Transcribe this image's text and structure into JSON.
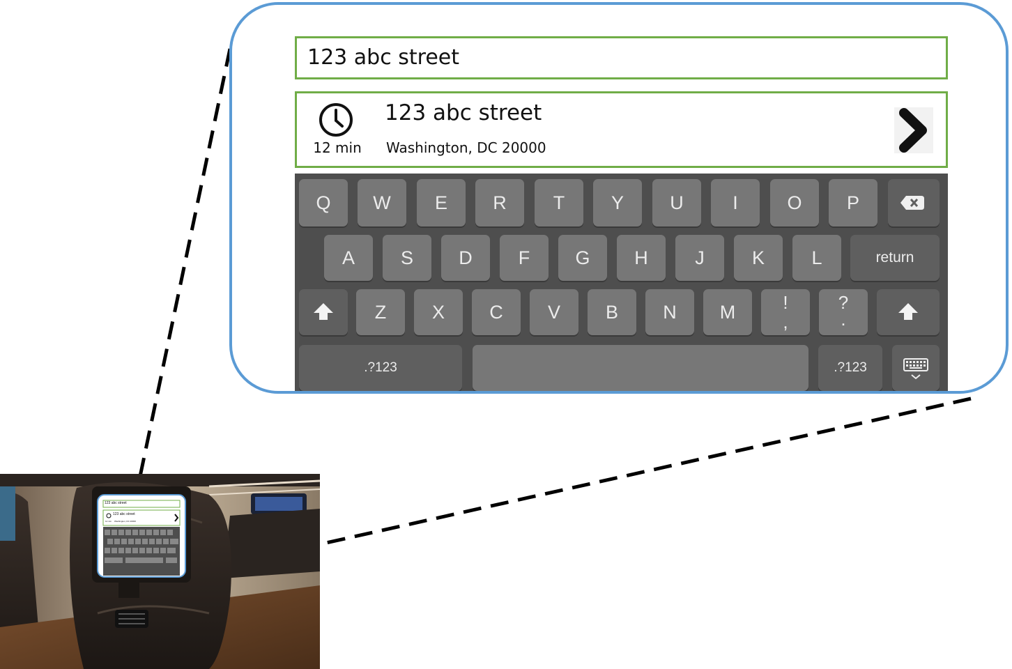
{
  "search": {
    "value": "123 abc street"
  },
  "result": {
    "eta": "12 min",
    "title": "123 abc street",
    "subtitle": "Washington, DC 20000"
  },
  "keyboard": {
    "row1": [
      "Q",
      "W",
      "E",
      "R",
      "T",
      "Y",
      "U",
      "I",
      "O",
      "P"
    ],
    "row2": [
      "A",
      "S",
      "D",
      "F",
      "G",
      "H",
      "J",
      "K",
      "L"
    ],
    "return_label": "return",
    "row3": [
      "Z",
      "X",
      "C",
      "V",
      "B",
      "N",
      "M"
    ],
    "punct1_top": "!",
    "punct1_bottom": ",",
    "punct2_top": "?",
    "punct2_bottom": ".",
    "numbers_label": ".?123"
  },
  "thumbnail_screen": {
    "search_value": "123 abc street",
    "result_title": "123 abc street",
    "result_eta": "12 min",
    "result_subtitle": "Washington, DC 20000"
  },
  "colors": {
    "callout_border": "#5b9bd5",
    "field_border": "#70ad47",
    "keyboard_bg": "#4e4e4e",
    "key_bg": "#777777"
  }
}
